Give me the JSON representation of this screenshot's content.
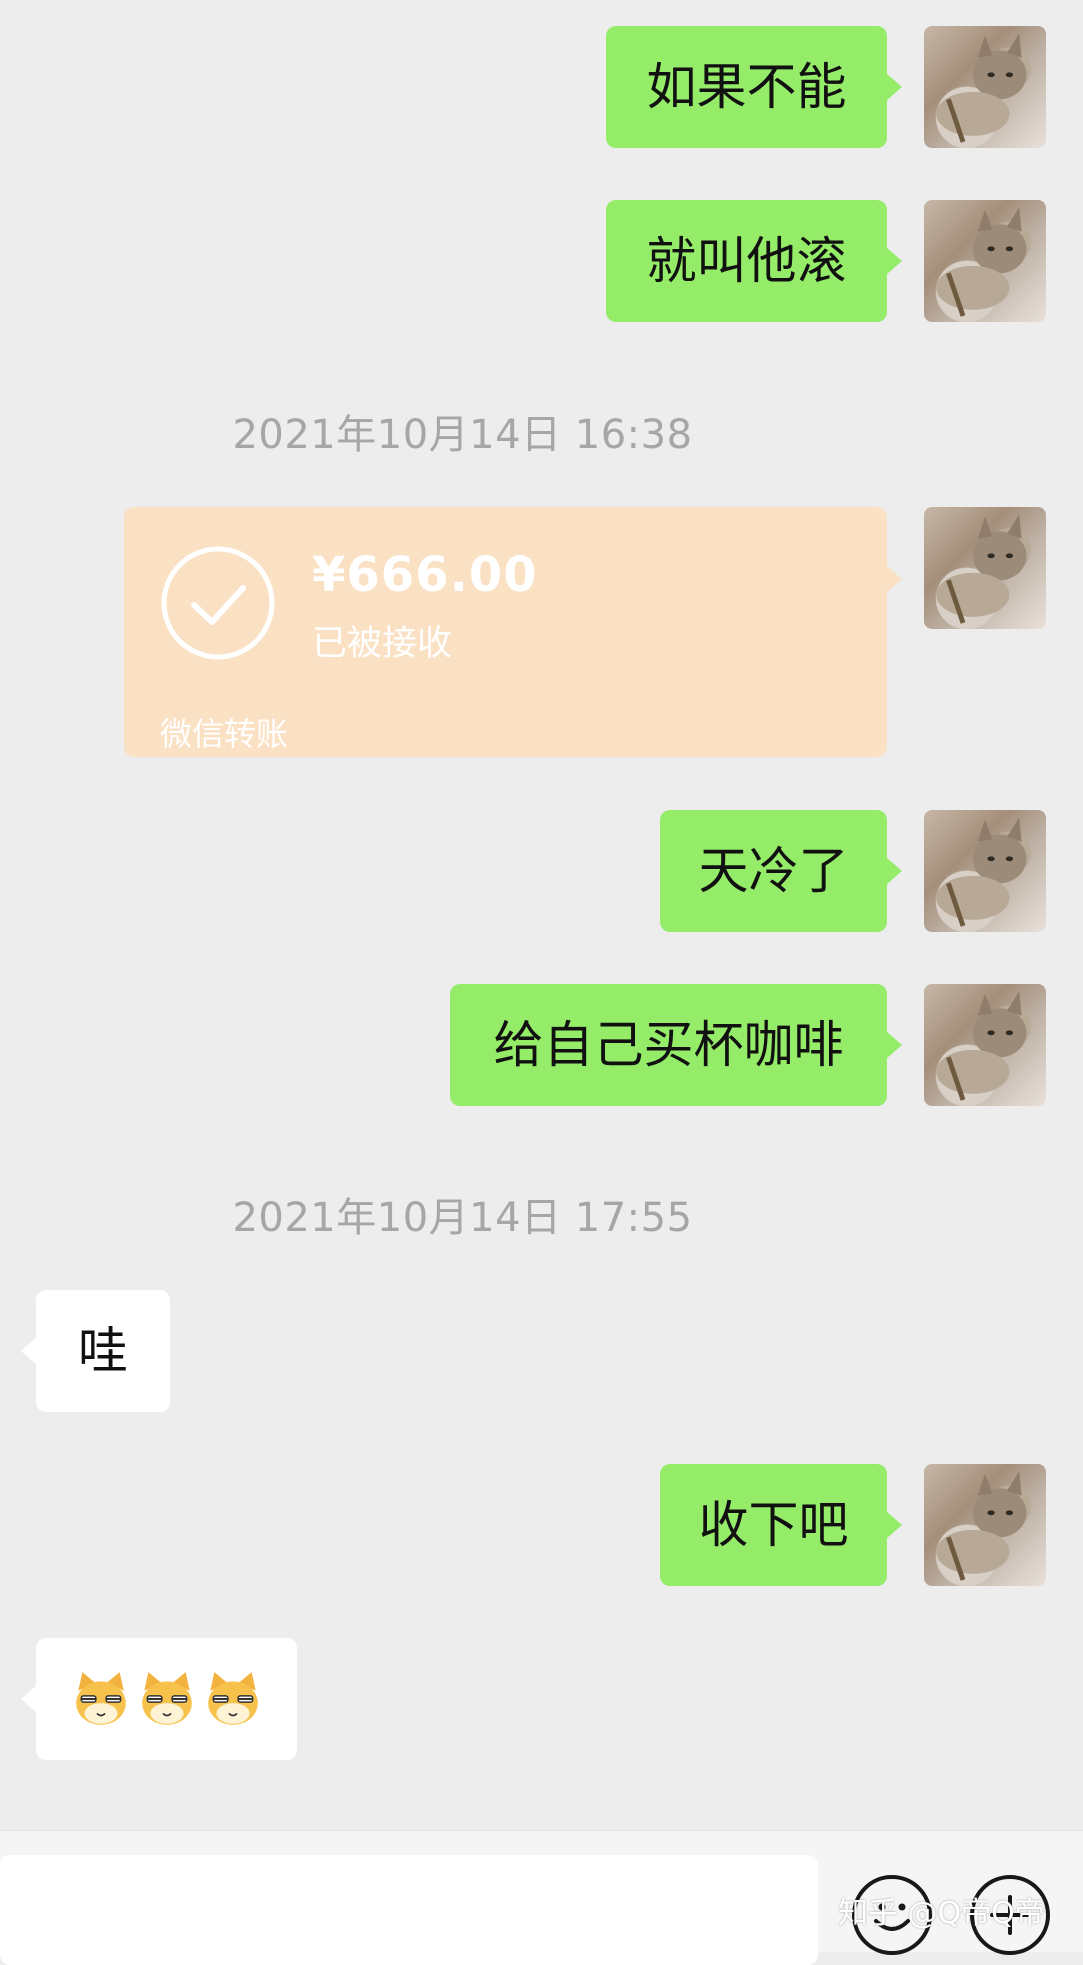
{
  "messages": {
    "m1": "如果不能",
    "m2": "就叫他滚",
    "m3": "天冷了",
    "m4": "给自己买杯咖啡",
    "m5": "哇",
    "m6": "收下吧"
  },
  "timestamps": {
    "t1": "2021年10月14日 16:38",
    "t2": "2021年10月14日 17:55"
  },
  "transfer": {
    "amount": "¥666.00",
    "status": "已被接收",
    "label": "微信转账"
  },
  "emoji_message": {
    "icons": [
      "cat-face-icon",
      "cat-face-icon",
      "cat-face-icon"
    ]
  },
  "watermark": "知乎 @Q帝Q帝",
  "colors": {
    "background": "#ededed",
    "sent_bubble": "#95ec69",
    "received_bubble": "#ffffff",
    "transfer_card": "#fbe1c4",
    "timestamp_text": "#a6a6a6"
  }
}
